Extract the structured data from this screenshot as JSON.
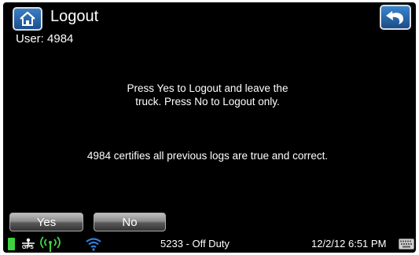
{
  "header": {
    "title": "Logout",
    "home_icon": "home-icon",
    "back_icon": "back-arrow-icon",
    "accent_color": "#2a66ad"
  },
  "user": {
    "label": "User: 4984"
  },
  "messages": {
    "instruction_line1": "Press Yes to Logout and leave the",
    "instruction_line2": "truck.  Press No to Logout only.",
    "certification": "4984 certifies all previous logs are true and correct."
  },
  "buttons": {
    "yes_label": "Yes",
    "no_label": "No"
  },
  "status_bar": {
    "battery_icon": "battery-icon",
    "battery_color": "#3fd23f",
    "gps_icon": "gps-icon",
    "gps_label": "GPS",
    "signal_icon": "signal-icon",
    "signal_color": "#3fd23f",
    "wifi_icon": "wifi-icon",
    "wifi_color": "#2f7fd8",
    "vehicle_status": "5233 - Off Duty",
    "datetime": "12/2/12 6:51 PM",
    "keyboard_icon": "keyboard-icon"
  }
}
